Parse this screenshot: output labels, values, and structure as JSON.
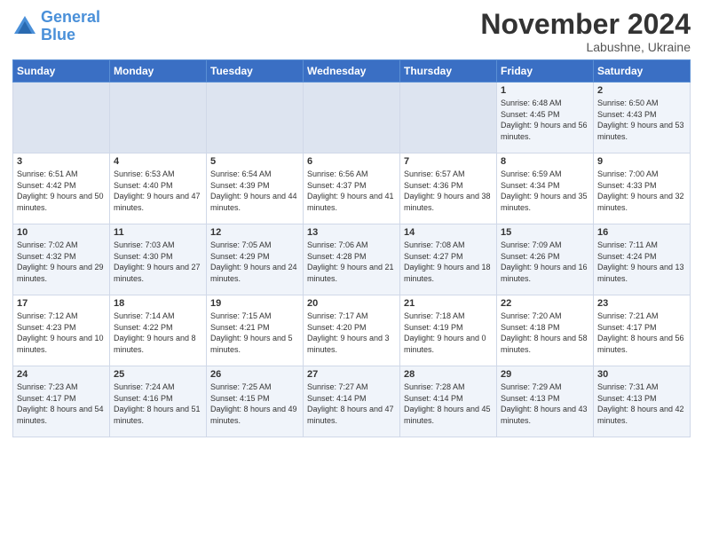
{
  "header": {
    "logo_line1": "General",
    "logo_line2": "Blue",
    "month_title": "November 2024",
    "location": "Labushne, Ukraine"
  },
  "days_of_week": [
    "Sunday",
    "Monday",
    "Tuesday",
    "Wednesday",
    "Thursday",
    "Friday",
    "Saturday"
  ],
  "weeks": [
    [
      {
        "day": "",
        "info": ""
      },
      {
        "day": "",
        "info": ""
      },
      {
        "day": "",
        "info": ""
      },
      {
        "day": "",
        "info": ""
      },
      {
        "day": "",
        "info": ""
      },
      {
        "day": "1",
        "info": "Sunrise: 6:48 AM\nSunset: 4:45 PM\nDaylight: 9 hours and 56 minutes."
      },
      {
        "day": "2",
        "info": "Sunrise: 6:50 AM\nSunset: 4:43 PM\nDaylight: 9 hours and 53 minutes."
      }
    ],
    [
      {
        "day": "3",
        "info": "Sunrise: 6:51 AM\nSunset: 4:42 PM\nDaylight: 9 hours and 50 minutes."
      },
      {
        "day": "4",
        "info": "Sunrise: 6:53 AM\nSunset: 4:40 PM\nDaylight: 9 hours and 47 minutes."
      },
      {
        "day": "5",
        "info": "Sunrise: 6:54 AM\nSunset: 4:39 PM\nDaylight: 9 hours and 44 minutes."
      },
      {
        "day": "6",
        "info": "Sunrise: 6:56 AM\nSunset: 4:37 PM\nDaylight: 9 hours and 41 minutes."
      },
      {
        "day": "7",
        "info": "Sunrise: 6:57 AM\nSunset: 4:36 PM\nDaylight: 9 hours and 38 minutes."
      },
      {
        "day": "8",
        "info": "Sunrise: 6:59 AM\nSunset: 4:34 PM\nDaylight: 9 hours and 35 minutes."
      },
      {
        "day": "9",
        "info": "Sunrise: 7:00 AM\nSunset: 4:33 PM\nDaylight: 9 hours and 32 minutes."
      }
    ],
    [
      {
        "day": "10",
        "info": "Sunrise: 7:02 AM\nSunset: 4:32 PM\nDaylight: 9 hours and 29 minutes."
      },
      {
        "day": "11",
        "info": "Sunrise: 7:03 AM\nSunset: 4:30 PM\nDaylight: 9 hours and 27 minutes."
      },
      {
        "day": "12",
        "info": "Sunrise: 7:05 AM\nSunset: 4:29 PM\nDaylight: 9 hours and 24 minutes."
      },
      {
        "day": "13",
        "info": "Sunrise: 7:06 AM\nSunset: 4:28 PM\nDaylight: 9 hours and 21 minutes."
      },
      {
        "day": "14",
        "info": "Sunrise: 7:08 AM\nSunset: 4:27 PM\nDaylight: 9 hours and 18 minutes."
      },
      {
        "day": "15",
        "info": "Sunrise: 7:09 AM\nSunset: 4:26 PM\nDaylight: 9 hours and 16 minutes."
      },
      {
        "day": "16",
        "info": "Sunrise: 7:11 AM\nSunset: 4:24 PM\nDaylight: 9 hours and 13 minutes."
      }
    ],
    [
      {
        "day": "17",
        "info": "Sunrise: 7:12 AM\nSunset: 4:23 PM\nDaylight: 9 hours and 10 minutes."
      },
      {
        "day": "18",
        "info": "Sunrise: 7:14 AM\nSunset: 4:22 PM\nDaylight: 9 hours and 8 minutes."
      },
      {
        "day": "19",
        "info": "Sunrise: 7:15 AM\nSunset: 4:21 PM\nDaylight: 9 hours and 5 minutes."
      },
      {
        "day": "20",
        "info": "Sunrise: 7:17 AM\nSunset: 4:20 PM\nDaylight: 9 hours and 3 minutes."
      },
      {
        "day": "21",
        "info": "Sunrise: 7:18 AM\nSunset: 4:19 PM\nDaylight: 9 hours and 0 minutes."
      },
      {
        "day": "22",
        "info": "Sunrise: 7:20 AM\nSunset: 4:18 PM\nDaylight: 8 hours and 58 minutes."
      },
      {
        "day": "23",
        "info": "Sunrise: 7:21 AM\nSunset: 4:17 PM\nDaylight: 8 hours and 56 minutes."
      }
    ],
    [
      {
        "day": "24",
        "info": "Sunrise: 7:23 AM\nSunset: 4:17 PM\nDaylight: 8 hours and 54 minutes."
      },
      {
        "day": "25",
        "info": "Sunrise: 7:24 AM\nSunset: 4:16 PM\nDaylight: 8 hours and 51 minutes."
      },
      {
        "day": "26",
        "info": "Sunrise: 7:25 AM\nSunset: 4:15 PM\nDaylight: 8 hours and 49 minutes."
      },
      {
        "day": "27",
        "info": "Sunrise: 7:27 AM\nSunset: 4:14 PM\nDaylight: 8 hours and 47 minutes."
      },
      {
        "day": "28",
        "info": "Sunrise: 7:28 AM\nSunset: 4:14 PM\nDaylight: 8 hours and 45 minutes."
      },
      {
        "day": "29",
        "info": "Sunrise: 7:29 AM\nSunset: 4:13 PM\nDaylight: 8 hours and 43 minutes."
      },
      {
        "day": "30",
        "info": "Sunrise: 7:31 AM\nSunset: 4:13 PM\nDaylight: 8 hours and 42 minutes."
      }
    ]
  ]
}
